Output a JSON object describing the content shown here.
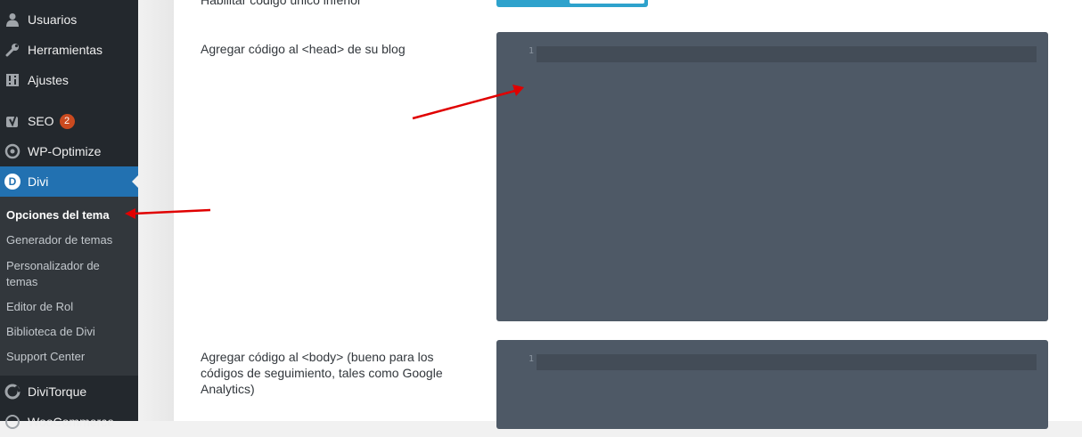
{
  "sidebar": {
    "items": [
      {
        "label": "Usuarios",
        "icon": "user-icon"
      },
      {
        "label": "Herramientas",
        "icon": "wrench-icon"
      },
      {
        "label": "Ajustes",
        "icon": "sliders-icon"
      },
      {
        "label": "SEO",
        "icon": "yoast-icon",
        "badge": "2"
      },
      {
        "label": "WP-Optimize",
        "icon": "wp-optimize-icon"
      },
      {
        "label": "Divi",
        "icon": "divi-icon",
        "icon_text": "D"
      },
      {
        "label": "DiviTorque",
        "icon": "divitorque-icon"
      },
      {
        "label": "WooCommerce",
        "icon": "woocommerce-icon"
      }
    ],
    "submenu": [
      {
        "label": "Opciones del tema"
      },
      {
        "label": "Generador de temas"
      },
      {
        "label": "Personalizador de temas"
      },
      {
        "label": "Editor de Rol"
      },
      {
        "label": "Biblioteca de Divi"
      },
      {
        "label": "Support Center"
      }
    ]
  },
  "settings": {
    "top_label": "Habilitar código único inferior",
    "head_label": "Agregar código al <head> de su blog",
    "body_label": "Agregar código al <body> (bueno para los códigos de seguimiento, tales como Google Analytics)",
    "line_number": "1"
  },
  "colors": {
    "sidebar_bg": "#23282d",
    "submenu_bg": "#32373c",
    "active_bg": "#2271b1",
    "badge_bg": "#ca4a1f",
    "editor_bg": "#4e5966",
    "arrow": "#e00000"
  }
}
